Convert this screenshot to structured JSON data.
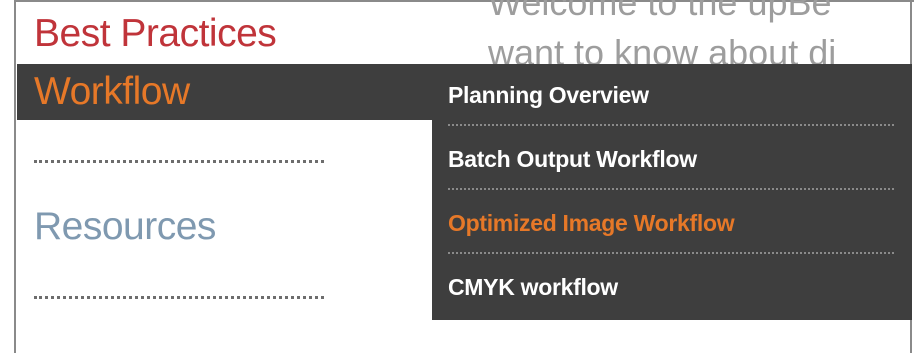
{
  "nav": {
    "best_practices": "Best Practices",
    "workflow": "Workflow",
    "resources": "Resources"
  },
  "background_text": {
    "line1": "Welcome to the upBe",
    "line2": "want to know about di"
  },
  "dropdown": {
    "items": [
      {
        "label": "Planning Overview",
        "active": false
      },
      {
        "label": "Batch Output Workflow",
        "active": false
      },
      {
        "label": "Optimized Image Workflow",
        "active": true
      },
      {
        "label": "CMYK workflow",
        "active": false
      }
    ]
  },
  "colors": {
    "best_practices": "#c0343a",
    "active_orange": "#e67828",
    "resources_blue": "#7f99b0",
    "menu_bg": "#3e3e3e",
    "menu_text": "#ffffff"
  }
}
